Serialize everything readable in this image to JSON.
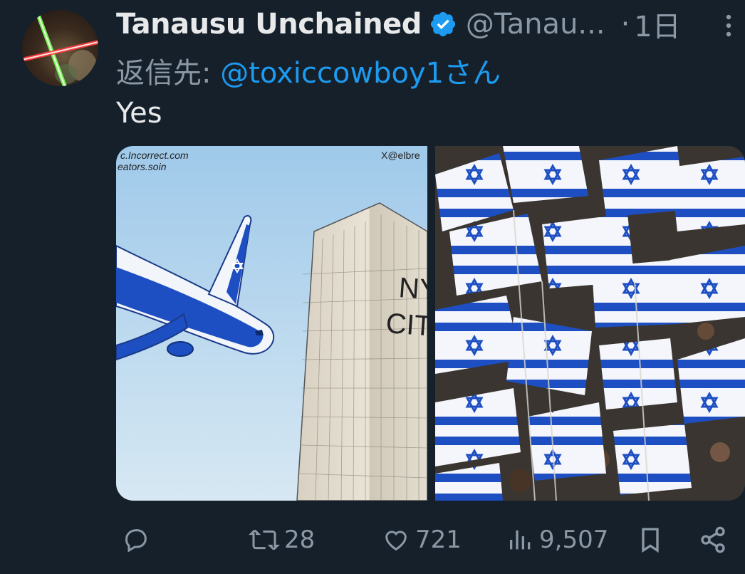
{
  "author": {
    "display_name": "Tanausu Unchained",
    "handle": "@Tanau...",
    "separator": "·",
    "time": "1日"
  },
  "reply": {
    "prefix": "返信先: ",
    "target": "@toxiccowboy1さん"
  },
  "tweet": {
    "text": "Yes"
  },
  "media": {
    "left": {
      "watermark_1": "c.Incorrect.com",
      "watermark_2": "eators.soin",
      "corner_tag": "X@elbre",
      "building_text_1": "NY",
      "building_text_2": "CITY"
    }
  },
  "actions": {
    "retweets": "28",
    "likes": "721",
    "views": "9,507"
  },
  "colors": {
    "background": "#15202b",
    "text": "#e7e9ea",
    "muted": "#8b98a5",
    "accent": "#1d9bf0",
    "flag_blue": "#1e4fc2"
  },
  "icons": [
    "verified-badge-icon",
    "more-icon",
    "reply-icon",
    "retweet-icon",
    "like-icon",
    "views-icon",
    "bookmark-icon",
    "share-icon"
  ]
}
